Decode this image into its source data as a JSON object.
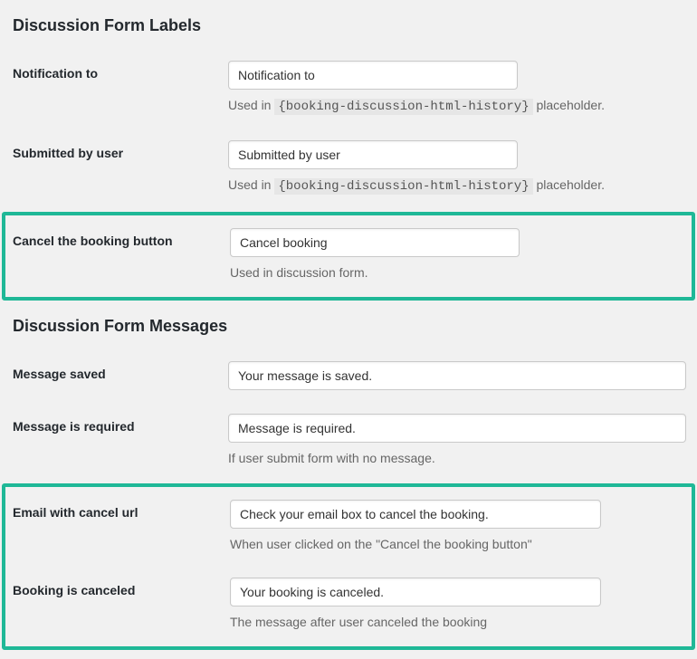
{
  "section1": {
    "title": "Discussion Form Labels",
    "fields": {
      "notification_to": {
        "label": "Notification to",
        "value": "Notification to",
        "help_prefix": "Used in ",
        "help_code": "{booking-discussion-html-history}",
        "help_suffix": " placeholder."
      },
      "submitted_by_user": {
        "label": "Submitted by user",
        "value": "Submitted by user",
        "help_prefix": "Used in ",
        "help_code": "{booking-discussion-html-history}",
        "help_suffix": " placeholder."
      },
      "cancel_button": {
        "label": "Cancel the booking button",
        "value": "Cancel booking",
        "help": "Used in discussion form."
      }
    }
  },
  "section2": {
    "title": "Discussion Form Messages",
    "fields": {
      "message_saved": {
        "label": "Message saved",
        "value": "Your message is saved."
      },
      "message_required": {
        "label": "Message is required",
        "value": "Message is required.",
        "help": "If user submit form with no message."
      },
      "email_cancel_url": {
        "label": "Email with cancel url",
        "value": "Check your email box to cancel the booking.",
        "help": "When user clicked on the \"Cancel the booking button\""
      },
      "booking_canceled": {
        "label": "Booking is canceled",
        "value": "Your booking is canceled.",
        "help": "The message after user canceled the booking"
      }
    }
  }
}
